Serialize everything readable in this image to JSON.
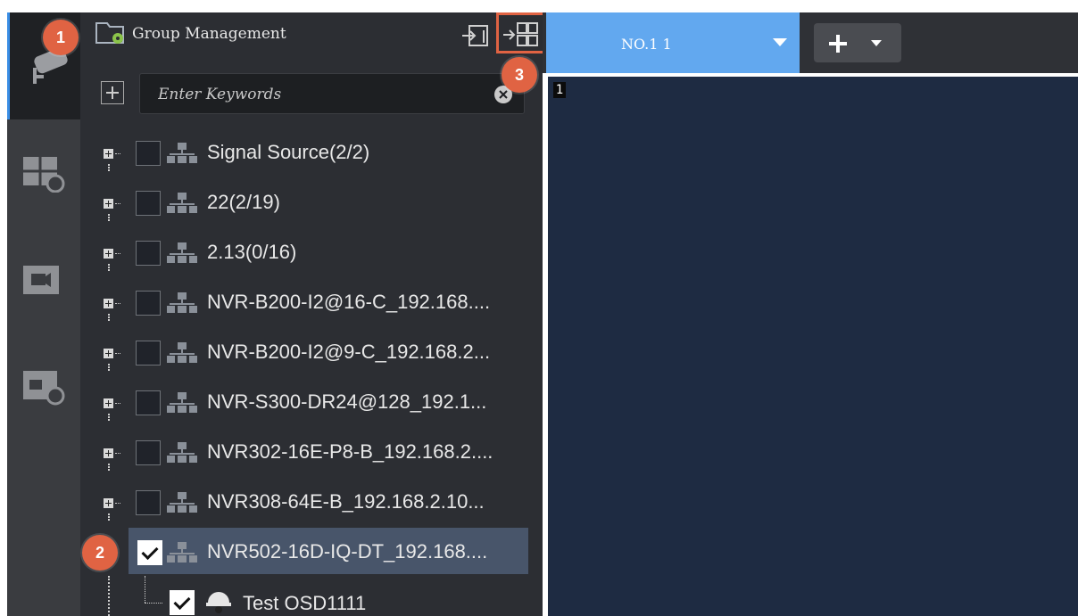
{
  "panel": {
    "title": "Group Management",
    "search_placeholder": "Enter Keywords"
  },
  "tree": [
    {
      "label": "Signal Source(2/2)",
      "checked": false
    },
    {
      "label": "22(2/19)",
      "checked": false
    },
    {
      "label": "2.13(0/16)",
      "checked": false
    },
    {
      "label": "NVR-B200-I2@16-C_192.168....",
      "checked": false
    },
    {
      "label": "NVR-B200-I2@9-C_192.168.2...",
      "checked": false
    },
    {
      "label": "NVR-S300-DR24@128_192.1...",
      "checked": false
    },
    {
      "label": "NVR302-16E-P8-B_192.168.2....",
      "checked": false
    },
    {
      "label": "NVR308-64E-B_192.168.2.10...",
      "checked": false
    },
    {
      "label": "NVR502-16D-IQ-DT_192.168....",
      "checked": true,
      "selected": true
    },
    {
      "label": "Test OSD1111",
      "checked": true,
      "child": true
    }
  ],
  "tabs": {
    "active_label": "NO.1 1"
  },
  "view": {
    "window_index": "1"
  },
  "badges": [
    "1",
    "2",
    "3"
  ],
  "colors": {
    "accent": "#62a8ef",
    "badge": "#e06343",
    "panel_bg": "#2c2e33",
    "view_bg": "#1e2b42",
    "selected_row": "#48556a"
  }
}
